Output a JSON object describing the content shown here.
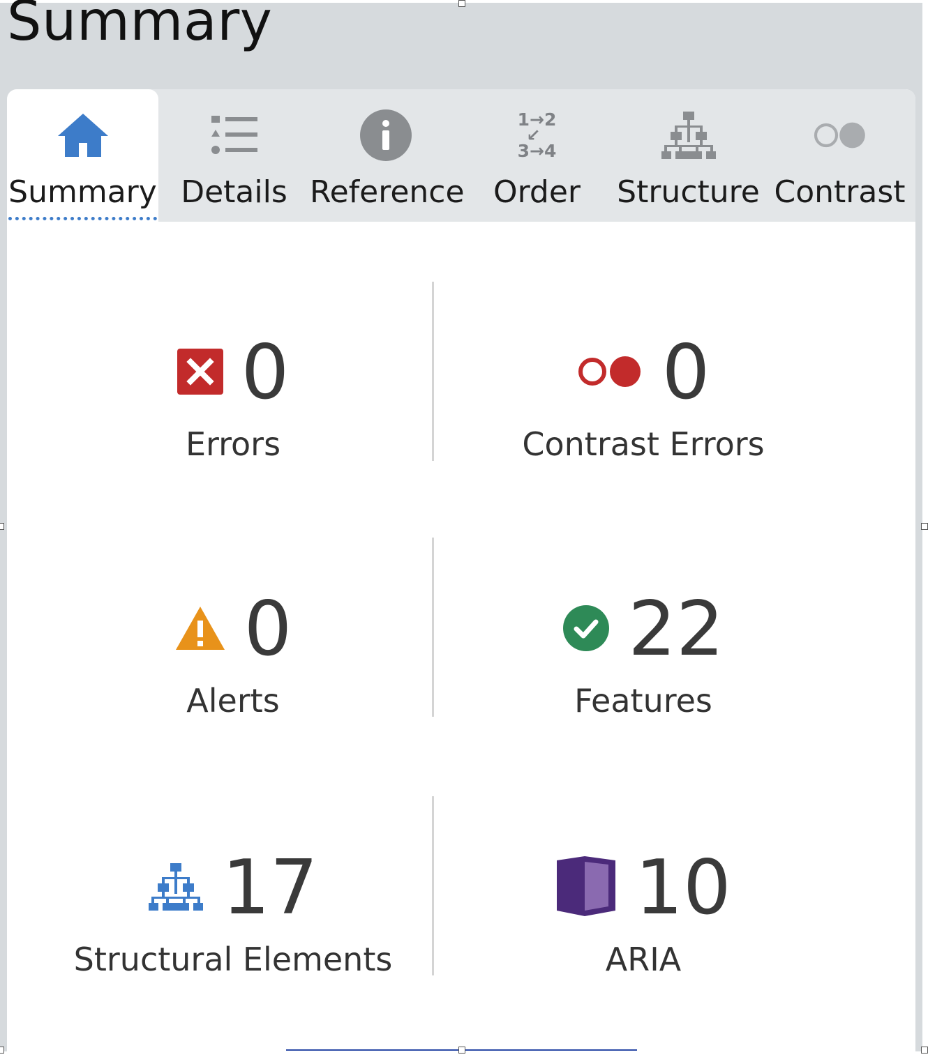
{
  "page": {
    "title": "Summary"
  },
  "tabs": [
    {
      "id": "summary",
      "label": "Summary",
      "icon": "home-icon",
      "active": true
    },
    {
      "id": "details",
      "label": "Details",
      "icon": "list-icon",
      "active": false
    },
    {
      "id": "reference",
      "label": "Reference",
      "icon": "info-icon",
      "active": false
    },
    {
      "id": "order",
      "label": "Order",
      "icon": "order-icon",
      "active": false
    },
    {
      "id": "structure",
      "label": "Structure",
      "icon": "hierarchy-icon",
      "active": false
    },
    {
      "id": "contrast",
      "label": "Contrast",
      "icon": "contrast-icon",
      "active": false
    }
  ],
  "order_icon": {
    "top": "1→2",
    "bottom": "3→4"
  },
  "stats": {
    "errors": {
      "value": "0",
      "label": "Errors",
      "icon": "error-x-icon",
      "color": "#c22b2b"
    },
    "contrast_errors": {
      "value": "0",
      "label": "Contrast Errors",
      "icon": "contrast-error-icon",
      "color": "#c22b2b"
    },
    "alerts": {
      "value": "0",
      "label": "Alerts",
      "icon": "warning-icon",
      "color": "#e8921a"
    },
    "features": {
      "value": "22",
      "label": "Features",
      "icon": "check-circle-icon",
      "color": "#2e8a57"
    },
    "structural": {
      "value": "17",
      "label": "Structural Elements",
      "icon": "hierarchy-icon",
      "color": "#3d7cc9"
    },
    "aria": {
      "value": "10",
      "label": "ARIA",
      "icon": "aria-box-icon",
      "color": "#4b2a7a"
    }
  },
  "colors": {
    "accent": "#3d7cc9",
    "tab_icon_gray": "#8a8d90"
  }
}
